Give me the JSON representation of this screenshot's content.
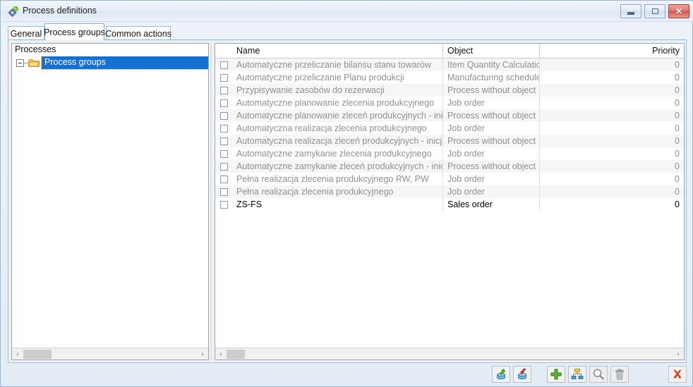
{
  "window": {
    "title": "Process definitions",
    "icon": "gear-icon",
    "buttons": {
      "minimize": "minimize-icon",
      "maximize": "maximize-icon",
      "close": "close-icon"
    }
  },
  "tabs": [
    {
      "label": "General",
      "active": false
    },
    {
      "label": "Process groups",
      "active": true
    },
    {
      "label": "Common actions",
      "active": false
    }
  ],
  "left_panel": {
    "header": "Processes",
    "tree": [
      {
        "label": "Process groups",
        "selected": true,
        "expanded": true,
        "icon": "folder-icon"
      }
    ]
  },
  "grid": {
    "columns": [
      {
        "key": "check",
        "label": ""
      },
      {
        "key": "name",
        "label": "Name"
      },
      {
        "key": "object",
        "label": "Object"
      },
      {
        "key": "priority",
        "label": "Priority"
      }
    ],
    "rows": [
      {
        "checked": false,
        "name": "Automatyczne przeliczanie bilansu stanu towarów",
        "object": "Item Quantity Calculation",
        "priority": "0",
        "bold": false
      },
      {
        "checked": false,
        "name": "Automatyczne przeliczanie Planu produkcji",
        "object": "Manufacturing schedule",
        "priority": "0",
        "bold": false
      },
      {
        "checked": false,
        "name": "Przypisywanie zasobów do rezerwacji",
        "object": "Process without object",
        "priority": "0",
        "bold": false
      },
      {
        "checked": false,
        "name": "Automatyczne planowanie zlecenia produkcyjnego",
        "object": "Job order",
        "priority": "0",
        "bold": false
      },
      {
        "checked": false,
        "name": "Automatyczne planowanie zleceń produkcyjnych - inicjalizacja",
        "object": "Process without object",
        "priority": "0",
        "bold": false
      },
      {
        "checked": false,
        "name": "Automatyczna realizacja zlecenia produkcyjnego",
        "object": "Job order",
        "priority": "0",
        "bold": false
      },
      {
        "checked": false,
        "name": "Automatyczna realizacja zleceń produkcyjnych - inicjalizacja",
        "object": "Process without object",
        "priority": "0",
        "bold": false
      },
      {
        "checked": false,
        "name": "Automatyczne zamykanie zlecenia produkcyjnego",
        "object": "Job order",
        "priority": "0",
        "bold": false
      },
      {
        "checked": false,
        "name": "Automatyczne zamykanie zleceń produkcyjnych - inicjalizacja",
        "object": "Process without object",
        "priority": "0",
        "bold": false
      },
      {
        "checked": false,
        "name": "Pełna realizacja zlecenia produkcyjnego RW, PW",
        "object": "Job order",
        "priority": "0",
        "bold": false
      },
      {
        "checked": false,
        "name": "Pełna realizacja zlecenia produkcyjnego",
        "object": "Job order",
        "priority": "0",
        "bold": false
      },
      {
        "checked": false,
        "name": "ZS-FS",
        "object": "Sales order",
        "priority": "0",
        "bold": true
      }
    ]
  },
  "toolbar": {
    "buttons": [
      {
        "name": "export-icon",
        "enabled": true
      },
      {
        "name": "import-icon",
        "enabled": true
      },
      {
        "name": "add-icon",
        "enabled": true
      },
      {
        "name": "group-icon",
        "enabled": true
      },
      {
        "name": "search-icon",
        "enabled": false
      },
      {
        "name": "delete-icon",
        "enabled": false
      },
      {
        "name": "close-x-icon",
        "enabled": true
      }
    ]
  },
  "scrollbars": {
    "left_arrow": "‹",
    "right_arrow": "›"
  },
  "colors": {
    "selection": "#1570d4",
    "tab_border": "#8cc0e8",
    "window_border": "#9cb6d4",
    "close_red": "#d2564a"
  }
}
